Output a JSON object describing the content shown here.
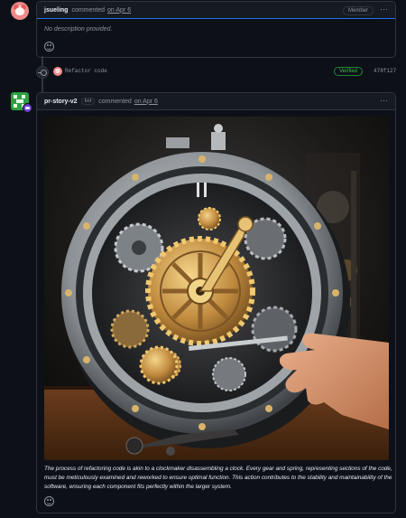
{
  "comment1": {
    "author": "jsueling",
    "action": "commented",
    "date_link": "on Apr 6",
    "badge": "Member",
    "menu_icon": "kebab-horizontal-icon",
    "body": "No description provided."
  },
  "commit": {
    "message": "Refactor code",
    "status": "Verified",
    "sha": "478f127"
  },
  "comment2": {
    "author": "pr-story-v2",
    "bot_badge": "bot",
    "action": "commented",
    "date_link": "on Apr 6",
    "menu_icon": "kebab-horizontal-icon",
    "image_subject": "clockmaker-gears-illustration",
    "caption": "The process of refactoring code is akin to a clockmaker disassembling a clock. Every gear and spring, representing sections of the code, must be meticulously examined and reworked to ensure optimal function. This action contributes to the stability and maintainability of the software, ensuring each component fits perfectly within the larger system."
  },
  "colors": {
    "background": "#0d1117",
    "border": "#30363d",
    "accent": "#1f6feb",
    "verified": "#3fb950",
    "bot_avatar": "#2ea043"
  }
}
